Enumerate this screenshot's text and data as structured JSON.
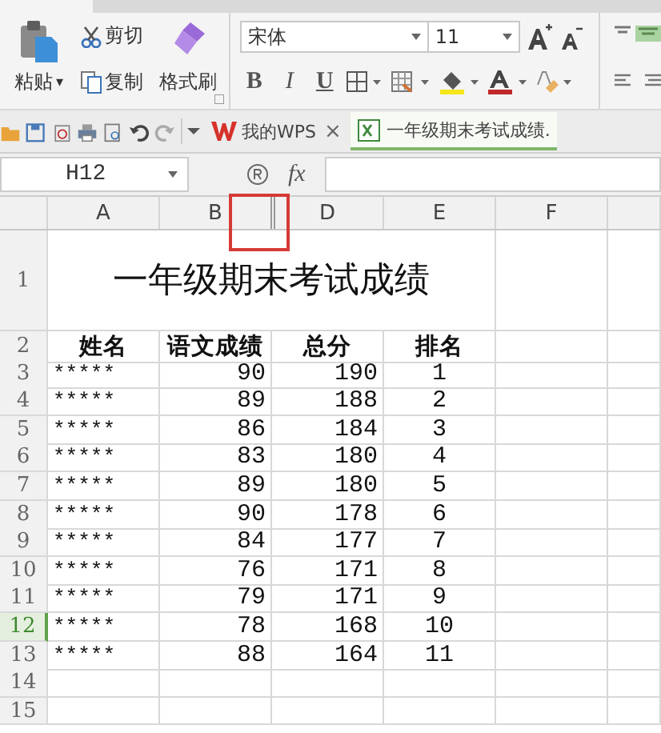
{
  "ribbon": {
    "paste": "粘贴",
    "paste_caret": "▾",
    "cut": "剪切",
    "copy": "复制",
    "format_painter": "格式刷",
    "font_name": "宋体",
    "font_size": "11",
    "bold": "B",
    "italic": "I",
    "underline": "U"
  },
  "tabs": [
    {
      "label": "我的WPS",
      "selected": false,
      "close": "×"
    },
    {
      "label": "一年级期末考试成绩.",
      "selected": true
    }
  ],
  "formula_bar": {
    "name_box": "H12",
    "fx": "fx"
  },
  "sheet": {
    "columns": [
      "A",
      "B",
      "D",
      "E",
      "F"
    ],
    "title_row": {
      "number": "1",
      "title": "一年级期末考试成绩"
    },
    "rows": [
      {
        "number": "2",
        "kind": "header",
        "selected": false,
        "cells": [
          "姓名",
          "语文成绩",
          "总分",
          "排名"
        ]
      },
      {
        "number": "3",
        "kind": "data",
        "selected": false,
        "cells": [
          "*****",
          "90",
          "190",
          "1"
        ]
      },
      {
        "number": "4",
        "kind": "data",
        "selected": false,
        "cells": [
          "*****",
          "89",
          "188",
          "2"
        ]
      },
      {
        "number": "5",
        "kind": "data",
        "selected": false,
        "cells": [
          "*****",
          "86",
          "184",
          "3"
        ]
      },
      {
        "number": "6",
        "kind": "data",
        "selected": false,
        "cells": [
          "*****",
          "83",
          "180",
          "4"
        ]
      },
      {
        "number": "7",
        "kind": "data",
        "selected": false,
        "cells": [
          "*****",
          "89",
          "180",
          "5"
        ]
      },
      {
        "number": "8",
        "kind": "data",
        "selected": false,
        "cells": [
          "*****",
          "90",
          "178",
          "6"
        ]
      },
      {
        "number": "9",
        "kind": "data",
        "selected": false,
        "cells": [
          "*****",
          "84",
          "177",
          "7"
        ]
      },
      {
        "number": "10",
        "kind": "data",
        "selected": false,
        "cells": [
          "*****",
          "76",
          "171",
          "8"
        ]
      },
      {
        "number": "11",
        "kind": "data",
        "selected": false,
        "cells": [
          "*****",
          "79",
          "171",
          "9"
        ]
      },
      {
        "number": "12",
        "kind": "data",
        "selected": true,
        "cells": [
          "*****",
          "78",
          "168",
          "10"
        ]
      },
      {
        "number": "13",
        "kind": "data",
        "selected": false,
        "cells": [
          "*****",
          "88",
          "164",
          "11"
        ]
      },
      {
        "number": "14",
        "kind": "empty",
        "selected": false
      },
      {
        "number": "15",
        "kind": "empty",
        "selected": false
      }
    ]
  }
}
